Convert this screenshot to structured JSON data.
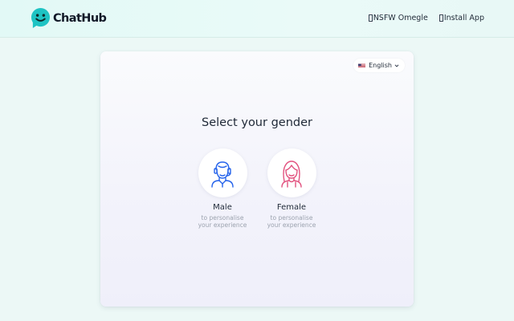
{
  "app": {
    "name": "ChatHub"
  },
  "nav": {
    "links": [
      {
        "label": "NSFW Omegle",
        "icon": "external-link-icon"
      },
      {
        "label": "Install App",
        "icon": "mobile-icon"
      }
    ]
  },
  "language": {
    "selected": "English",
    "flag": "us-flag-icon"
  },
  "gender": {
    "title": "Select your gender",
    "options": [
      {
        "label": "Male",
        "subtitle_line1": "to personalise",
        "subtitle_line2": "your experience",
        "color": "#2563eb"
      },
      {
        "label": "Female",
        "subtitle_line1": "to personalise",
        "subtitle_line2": "your experience",
        "color": "#e2527f"
      }
    ]
  },
  "colors": {
    "brand": "#1ec3c3",
    "background": "#ecf8f6",
    "male_accent": "#2563eb",
    "female_accent": "#e2527f"
  }
}
